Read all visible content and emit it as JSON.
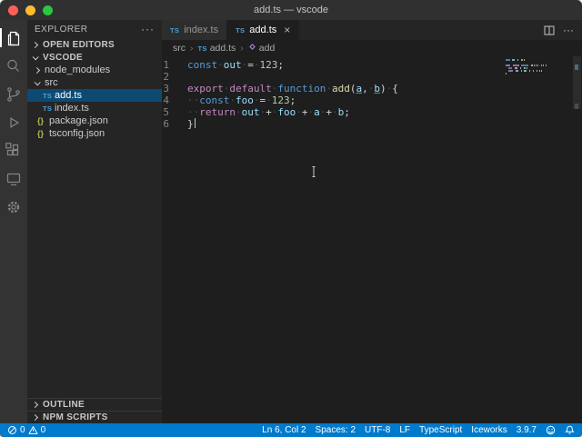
{
  "window": {
    "title": "add.ts — vscode"
  },
  "activity_bar": {
    "items": [
      {
        "id": "explorer",
        "active": true
      },
      {
        "id": "search",
        "active": false
      },
      {
        "id": "source-control",
        "active": false
      },
      {
        "id": "run-debug",
        "active": false
      },
      {
        "id": "extensions",
        "active": false
      },
      {
        "id": "iceworks",
        "active": false
      },
      {
        "id": "settings",
        "active": false
      }
    ]
  },
  "sidebar": {
    "title": "EXPLORER",
    "open_editors_label": "OPEN EDITORS",
    "workspace_label": "VSCODE",
    "outline_label": "OUTLINE",
    "npm_scripts_label": "NPM SCRIPTS",
    "tree": [
      {
        "label": "node_modules",
        "kind": "folder",
        "expanded": false,
        "depth": 0,
        "selected": false
      },
      {
        "label": "src",
        "kind": "folder",
        "expanded": true,
        "depth": 0,
        "selected": false
      },
      {
        "label": "add.ts",
        "kind": "file-ts",
        "depth": 1,
        "selected": true
      },
      {
        "label": "index.ts",
        "kind": "file-ts",
        "depth": 1,
        "selected": false
      },
      {
        "label": "package.json",
        "kind": "file-json",
        "depth": 0,
        "selected": false
      },
      {
        "label": "tsconfig.json",
        "kind": "file-json",
        "depth": 0,
        "selected": false
      }
    ]
  },
  "editor_tabs": [
    {
      "label": "index.ts",
      "icon": "ts",
      "active": false
    },
    {
      "label": "add.ts",
      "icon": "ts",
      "active": true
    }
  ],
  "breadcrumbs": [
    {
      "label": "src",
      "icon": null
    },
    {
      "label": "add.ts",
      "icon": "ts"
    },
    {
      "label": "add",
      "icon": "method"
    }
  ],
  "code": {
    "language": "typescript",
    "plain_text": "const out = 123;\n\nexport default function add(a, b) {\n  const foo = 123;\n  return out + foo + a + b;\n}",
    "lines": [
      {
        "num": "1",
        "caret_after": false,
        "tokens": [
          [
            "const",
            "kw"
          ],
          [
            "·",
            "ws"
          ],
          [
            "out",
            "var"
          ],
          [
            "·",
            "ws"
          ],
          [
            "=",
            "op"
          ],
          [
            "·",
            "ws"
          ],
          [
            "123",
            "num"
          ],
          [
            ";",
            "pun"
          ]
        ]
      },
      {
        "num": "2",
        "caret_after": false,
        "tokens": []
      },
      {
        "num": "3",
        "caret_after": false,
        "tokens": [
          [
            "export",
            "ctl"
          ],
          [
            "·",
            "ws"
          ],
          [
            "default",
            "ctl"
          ],
          [
            "·",
            "ws"
          ],
          [
            "function",
            "kw"
          ],
          [
            "·",
            "ws"
          ],
          [
            "add",
            "fn"
          ],
          [
            "(",
            "pun"
          ],
          [
            "a",
            "param"
          ],
          [
            ",",
            "pun"
          ],
          [
            "·",
            "ws"
          ],
          [
            "b",
            "param"
          ],
          [
            ")",
            "pun"
          ],
          [
            "·",
            "ws"
          ],
          [
            "{",
            "pun"
          ]
        ]
      },
      {
        "num": "4",
        "caret_after": false,
        "tokens": [
          [
            "··",
            "ws"
          ],
          [
            "const",
            "kw"
          ],
          [
            "·",
            "ws"
          ],
          [
            "foo",
            "var"
          ],
          [
            "·",
            "ws"
          ],
          [
            "=",
            "op"
          ],
          [
            "·",
            "ws"
          ],
          [
            "123",
            "num"
          ],
          [
            ";",
            "pun"
          ]
        ]
      },
      {
        "num": "5",
        "caret_after": false,
        "tokens": [
          [
            "··",
            "ws"
          ],
          [
            "return",
            "ctl"
          ],
          [
            "·",
            "ws"
          ],
          [
            "out",
            "var"
          ],
          [
            "·",
            "ws"
          ],
          [
            "+",
            "op"
          ],
          [
            "·",
            "ws"
          ],
          [
            "foo",
            "var"
          ],
          [
            "·",
            "ws"
          ],
          [
            "+",
            "op"
          ],
          [
            "·",
            "ws"
          ],
          [
            "a",
            "var"
          ],
          [
            "·",
            "ws"
          ],
          [
            "+",
            "op"
          ],
          [
            "·",
            "ws"
          ],
          [
            "b",
            "var"
          ],
          [
            ";",
            "pun"
          ]
        ]
      },
      {
        "num": "6",
        "caret_after": true,
        "tokens": [
          [
            "}",
            "pun"
          ]
        ]
      }
    ]
  },
  "status_bar": {
    "errors": "0",
    "warnings": "0",
    "items": [
      "Ln 6, Col 2",
      "Spaces: 2",
      "UTF-8",
      "LF",
      "TypeScript",
      "Iceworks",
      "3.9.7"
    ]
  },
  "icons": {
    "activity": [
      "files-icon",
      "search-icon",
      "source-control-icon",
      "run-debug-icon",
      "extensions-icon",
      "iceworks-icon",
      "gear-icon"
    ],
    "status": [
      "errors-icon",
      "warnings-icon",
      "feedback-smiley-icon",
      "bell-icon"
    ]
  },
  "colors": {
    "status_bar": "#007acc",
    "activity_bar": "#333333",
    "sidebar": "#252526",
    "editor": "#1e1e1e",
    "title_bar": "#303031",
    "tree_selection": "#0c4a73",
    "ts_icon": "#4d9fd6",
    "json_icon": "#b9b955"
  }
}
